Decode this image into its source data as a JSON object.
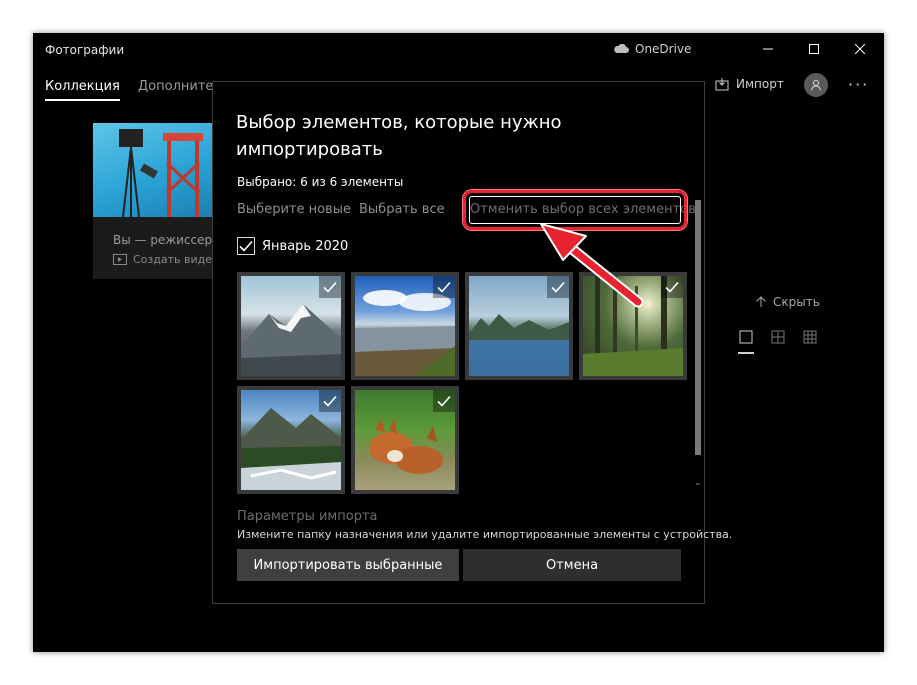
{
  "app": {
    "title": "Фотографии",
    "onedrive_label": "OneDrive"
  },
  "nav": {
    "tab_collection": "Коллекция",
    "tab_extra": "Дополнител",
    "import_label": "Импорт"
  },
  "card": {
    "line1": "Вы — режиссер",
    "line2": "Создать видео"
  },
  "side": {
    "hide_label": "Скрыть"
  },
  "dialog": {
    "title": "Выбор элементов, которые нужно импортировать",
    "selected_count": "Выбрано: 6 из 6 элементы",
    "link_select_new": "Выберите новые",
    "link_select_all": "Выбрать все",
    "link_deselect_all": "Отменить выбор всех элементов",
    "group_label": "Январь 2020",
    "photos": [
      {
        "subject": "snowy-mountain",
        "checked": true
      },
      {
        "subject": "lake-clouds",
        "checked": true
      },
      {
        "subject": "misty-lake",
        "checked": true
      },
      {
        "subject": "sunlit-forest",
        "checked": true
      },
      {
        "subject": "mountain-river",
        "checked": true
      },
      {
        "subject": "fox-pair",
        "checked": true
      }
    ],
    "params_title": "Параметры импорта",
    "params_desc": "Измените папку назначения или удалите импортированные элементы с устройства.",
    "btn_import": "Импортировать выбранные",
    "btn_cancel": "Отмена"
  },
  "colors": {
    "highlight": "#e8222f",
    "window_bg": "#000000",
    "button_bg": "#3f3f3f"
  }
}
